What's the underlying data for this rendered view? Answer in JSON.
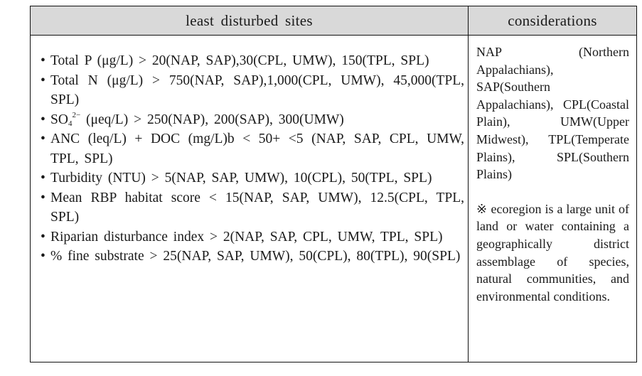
{
  "table": {
    "headers": {
      "col1": "least disturbed sites",
      "col2": "considerations"
    },
    "criteria": [
      {
        "bullet": "•",
        "text": "Total P (μg/L) > 20(NAP, SAP),30(CPL, UMW), 150(TPL, SPL)"
      },
      {
        "bullet": "•",
        "text": "Total N (μg/L) > 750(NAP, SAP),1,000(CPL, UMW), 45,000(TPL, SPL)"
      },
      {
        "bullet": "•",
        "prefix": "SO",
        "sub": "4",
        "sup": "2−",
        "text": " (μeq/L) > 250(NAP), 200(SAP), 300(UMW)"
      },
      {
        "bullet": "•",
        "text": "ANC (leq/L) + DOC (mg/L)b < 50+ <5 (NAP, SAP, CPL, UMW, TPL, SPL)"
      },
      {
        "bullet": "•",
        "text": "Turbidity (NTU) > 5(NAP, SAP, UMW), 10(CPL), 50(TPL, SPL)"
      },
      {
        "bullet": "•",
        "text": "Mean RBP habitat score < 15(NAP, SAP, UMW), 12.5(CPL, TPL, SPL)"
      },
      {
        "bullet": "•",
        "text": "Riparian disturbance index > 2(NAP, SAP, CPL, UMW, TPL, SPL)"
      },
      {
        "bullet": "•",
        "text": "% fine substrate > 25(NAP, SAP, UMW), 50(CPL), 80(TPL), 90(SPL)"
      }
    ],
    "considerations": {
      "ecoregions": "NAP (Northern Appalachians), SAP(Southern Appalachians), CPL(Coastal Plain), UMW(Upper Midwest), TPL(Temperate Plains), SPL(Southern Plains)",
      "note_symbol": "※",
      "note": "ecoregion is a large unit of land or water containing a geographically district assemblage of species, natural communities, and environmental conditions."
    }
  }
}
